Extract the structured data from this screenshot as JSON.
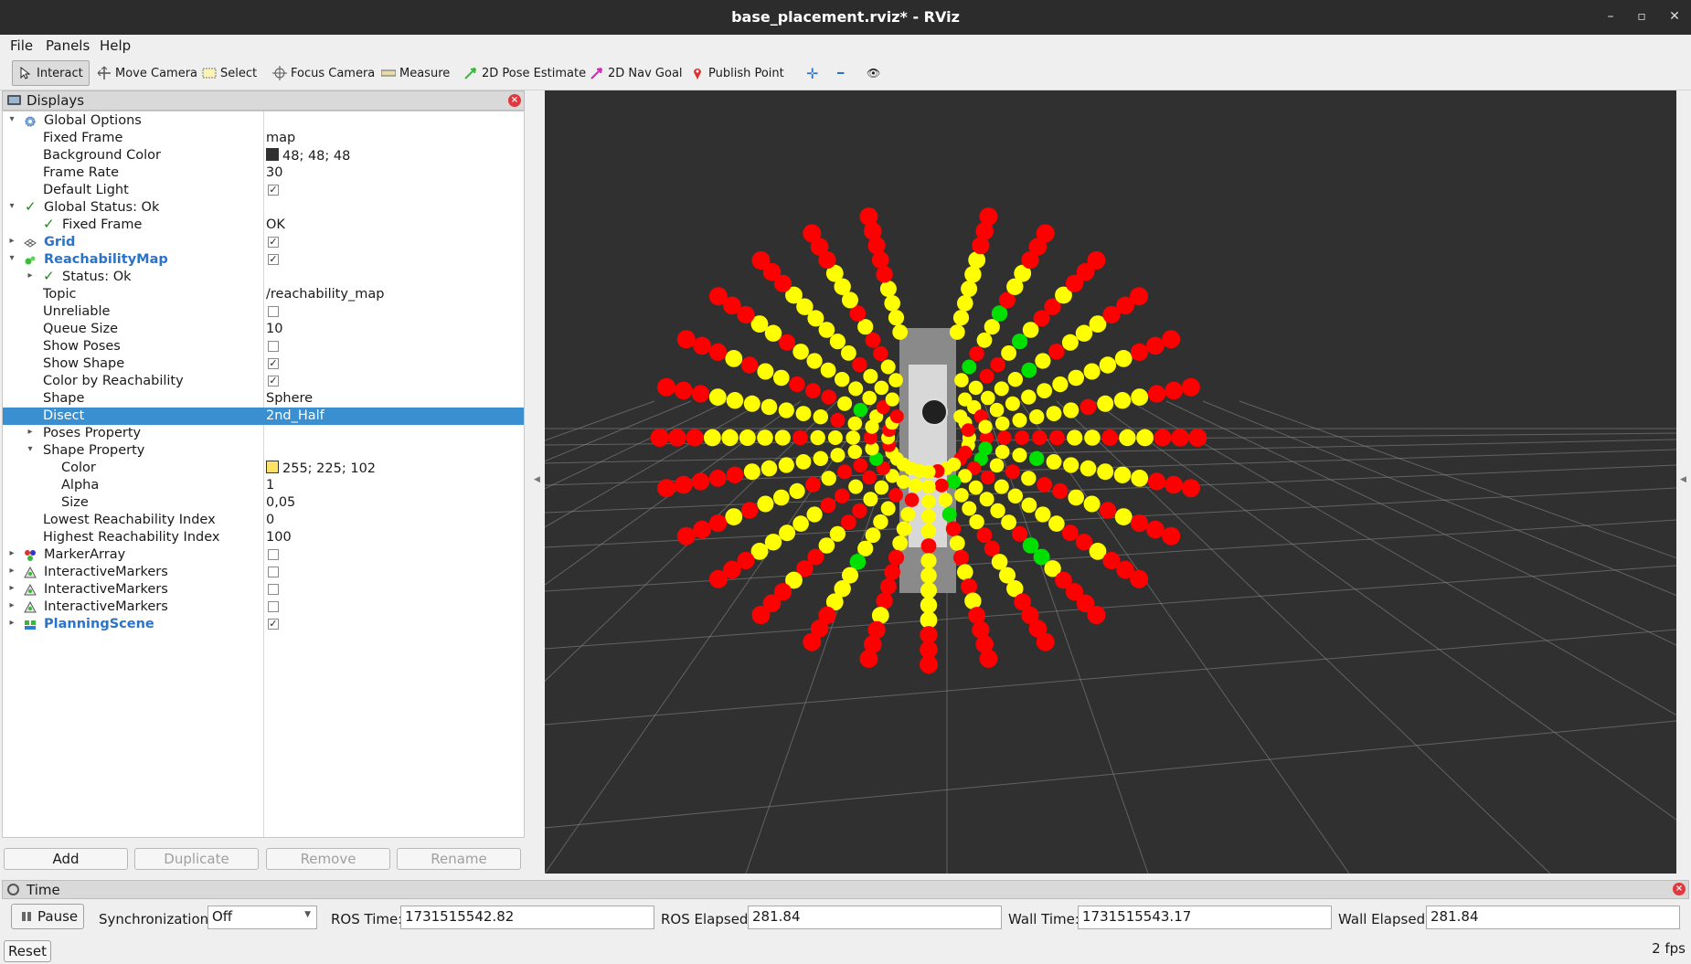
{
  "window": {
    "title": "base_placement.rviz* - RViz",
    "btn_min": "–",
    "btn_max": "▫",
    "btn_close": "✕"
  },
  "menu": {
    "file": "File",
    "panels": "Panels",
    "help": "Help"
  },
  "toolbar": {
    "interact": "Interact",
    "move_camera": "Move Camera",
    "select": "Select",
    "focus_camera": "Focus Camera",
    "measure": "Measure",
    "pose_estimate": "2D Pose Estimate",
    "nav_goal": "2D Nav Goal",
    "publish_point": "Publish Point",
    "plus": "✛",
    "minus": "━",
    "eye": "👁"
  },
  "displays": {
    "title": "Displays",
    "close": "×",
    "rows": [
      {
        "label": "Global Options",
        "value": ""
      },
      {
        "label": "Fixed Frame",
        "value": "map"
      },
      {
        "label": "Background Color",
        "value": "48; 48; 48"
      },
      {
        "label": "Frame Rate",
        "value": "30"
      },
      {
        "label": "Default Light",
        "value": "✓"
      },
      {
        "label": "Global Status: Ok",
        "value": ""
      },
      {
        "label": "Fixed Frame",
        "value": "OK"
      },
      {
        "label": "Grid",
        "value": "✓"
      },
      {
        "label": "ReachabilityMap",
        "value": "✓"
      },
      {
        "label": "Status: Ok",
        "value": ""
      },
      {
        "label": "Topic",
        "value": "/reachability_map"
      },
      {
        "label": "Unreliable",
        "value": ""
      },
      {
        "label": "Queue Size",
        "value": "10"
      },
      {
        "label": "Show Poses",
        "value": ""
      },
      {
        "label": "Show Shape",
        "value": "✓"
      },
      {
        "label": "Color by Reachability",
        "value": "✓"
      },
      {
        "label": "Shape",
        "value": "Sphere"
      },
      {
        "label": "Disect",
        "value": "2nd_Half"
      },
      {
        "label": "Poses Property",
        "value": ""
      },
      {
        "label": "Shape Property",
        "value": ""
      },
      {
        "label": "Color",
        "value": "255; 225; 102"
      },
      {
        "label": "Alpha",
        "value": "1"
      },
      {
        "label": "Size",
        "value": "0,05"
      },
      {
        "label": "Lowest Reachability Index",
        "value": "0"
      },
      {
        "label": "Highest Reachability Index",
        "value": "100"
      },
      {
        "label": "MarkerArray",
        "value": ""
      },
      {
        "label": "InteractiveMarkers",
        "value": ""
      },
      {
        "label": "InteractiveMarkers",
        "value": ""
      },
      {
        "label": "InteractiveMarkers",
        "value": ""
      },
      {
        "label": "PlanningScene",
        "value": "✓"
      }
    ],
    "colors": {
      "background": "#303030",
      "shape": "#ffe166",
      "selection": "#3a8fd0"
    },
    "buttons": {
      "add": "Add",
      "duplicate": "Duplicate",
      "remove": "Remove",
      "rename": "Rename"
    }
  },
  "time": {
    "title": "Time",
    "pause": "Pause",
    "sync_label": "Synchronization:",
    "sync_value": "Off",
    "ros_time_label": "ROS Time:",
    "ros_time": "1731515542.82",
    "ros_elapsed_label": "ROS Elapsed:",
    "ros_elapsed": "281.84",
    "wall_time_label": "Wall Time:",
    "wall_time": "1731515543.17",
    "wall_elapsed_label": "Wall Elapsed:",
    "wall_elapsed": "281.84",
    "reset": "Reset",
    "fps": "2 fps"
  }
}
